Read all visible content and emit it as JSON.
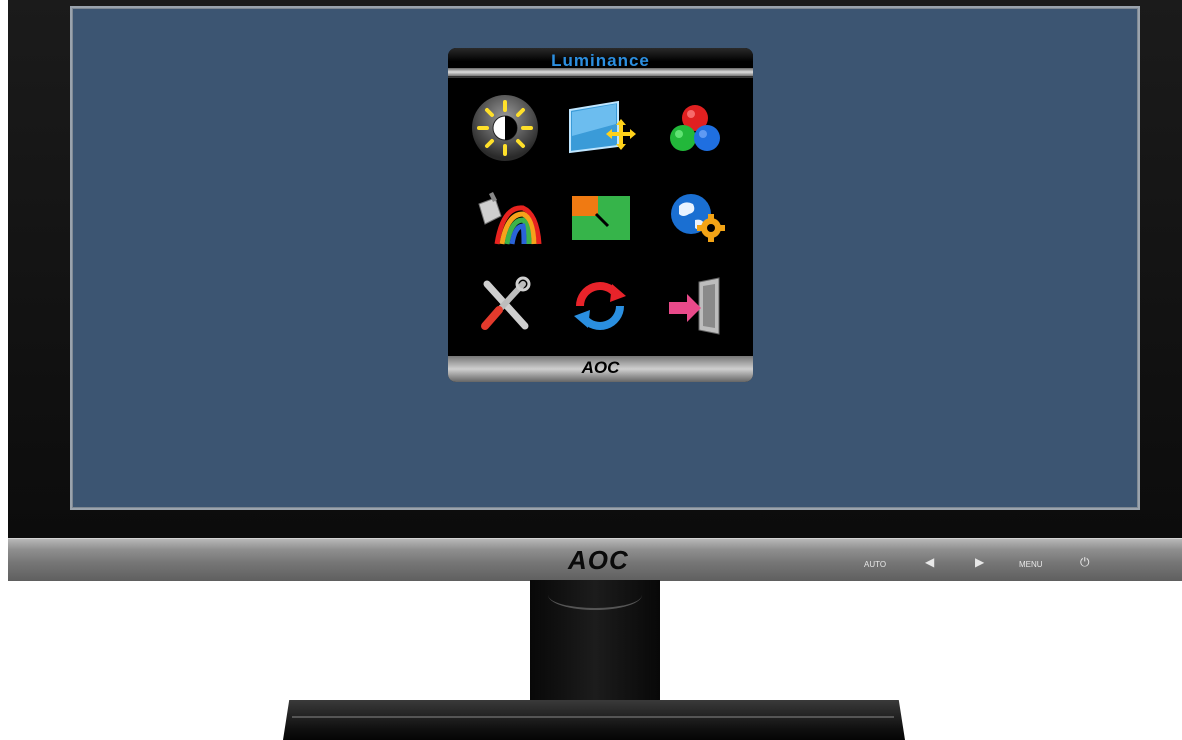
{
  "osd": {
    "title": "Luminance",
    "footer_logo": "AOC",
    "icons": [
      "luminance-icon",
      "image-setup-icon",
      "color-temp-icon",
      "color-boost-icon",
      "picture-boost-icon",
      "osd-setup-icon",
      "extra-icon",
      "reset-icon",
      "exit-icon"
    ]
  },
  "monitor": {
    "brand_logo": "AOC",
    "buttons": {
      "auto": "AUTO",
      "left": "◀",
      "right": "▶",
      "menu": "MENU",
      "power": "⏻"
    }
  },
  "colors": {
    "screen": "#3c5572",
    "osd_title": "#2c8fe0"
  }
}
